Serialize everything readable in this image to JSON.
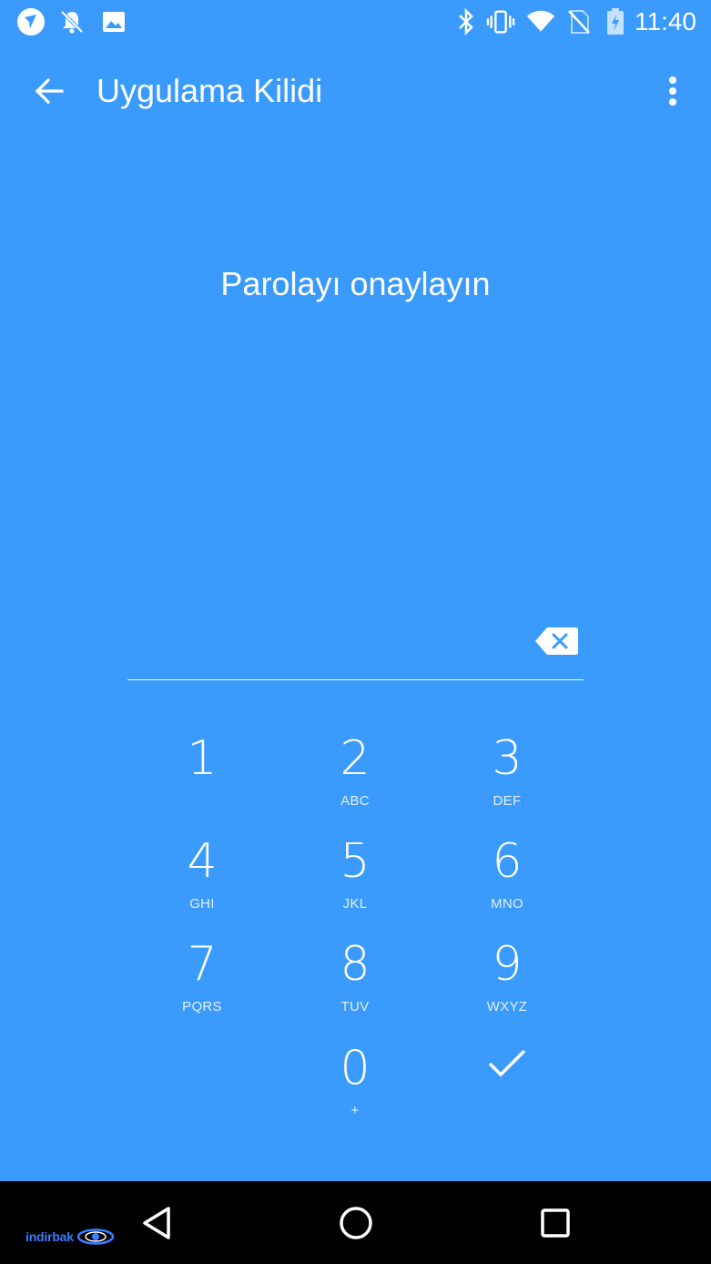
{
  "colors": {
    "accent": "#3a9bfc",
    "text": "#ffffff",
    "navbar": "#000000",
    "watermark": "#3a7dff"
  },
  "status_bar": {
    "time": "11:40",
    "left_icons": [
      "messenger-icon",
      "notifications-off-icon",
      "image-icon"
    ],
    "right_icons": [
      "bluetooth-icon",
      "vibrate-icon",
      "wifi-icon",
      "no-sim-icon",
      "battery-charging-icon"
    ]
  },
  "app_bar": {
    "title": "Uygulama Kilidi",
    "back_icon": "arrow-back-icon",
    "menu_icon": "more-vert-icon"
  },
  "prompt": "Parolayı onaylayın",
  "password_field": {
    "value": "",
    "clear_icon": "backspace-icon"
  },
  "keypad": {
    "keys": [
      {
        "digit": "1",
        "letters": ""
      },
      {
        "digit": "2",
        "letters": "ABC"
      },
      {
        "digit": "3",
        "letters": "DEF"
      },
      {
        "digit": "4",
        "letters": "GHI"
      },
      {
        "digit": "5",
        "letters": "JKL"
      },
      {
        "digit": "6",
        "letters": "MNO"
      },
      {
        "digit": "7",
        "letters": "PQRS"
      },
      {
        "digit": "8",
        "letters": "TUV"
      },
      {
        "digit": "9",
        "letters": "WXYZ"
      },
      {
        "digit": "0",
        "letters": "+"
      }
    ],
    "confirm_icon": "check-icon"
  },
  "nav_bar": {
    "icons": [
      "nav-back-icon",
      "nav-home-icon",
      "nav-recents-icon"
    ],
    "watermark": "indirbak"
  }
}
